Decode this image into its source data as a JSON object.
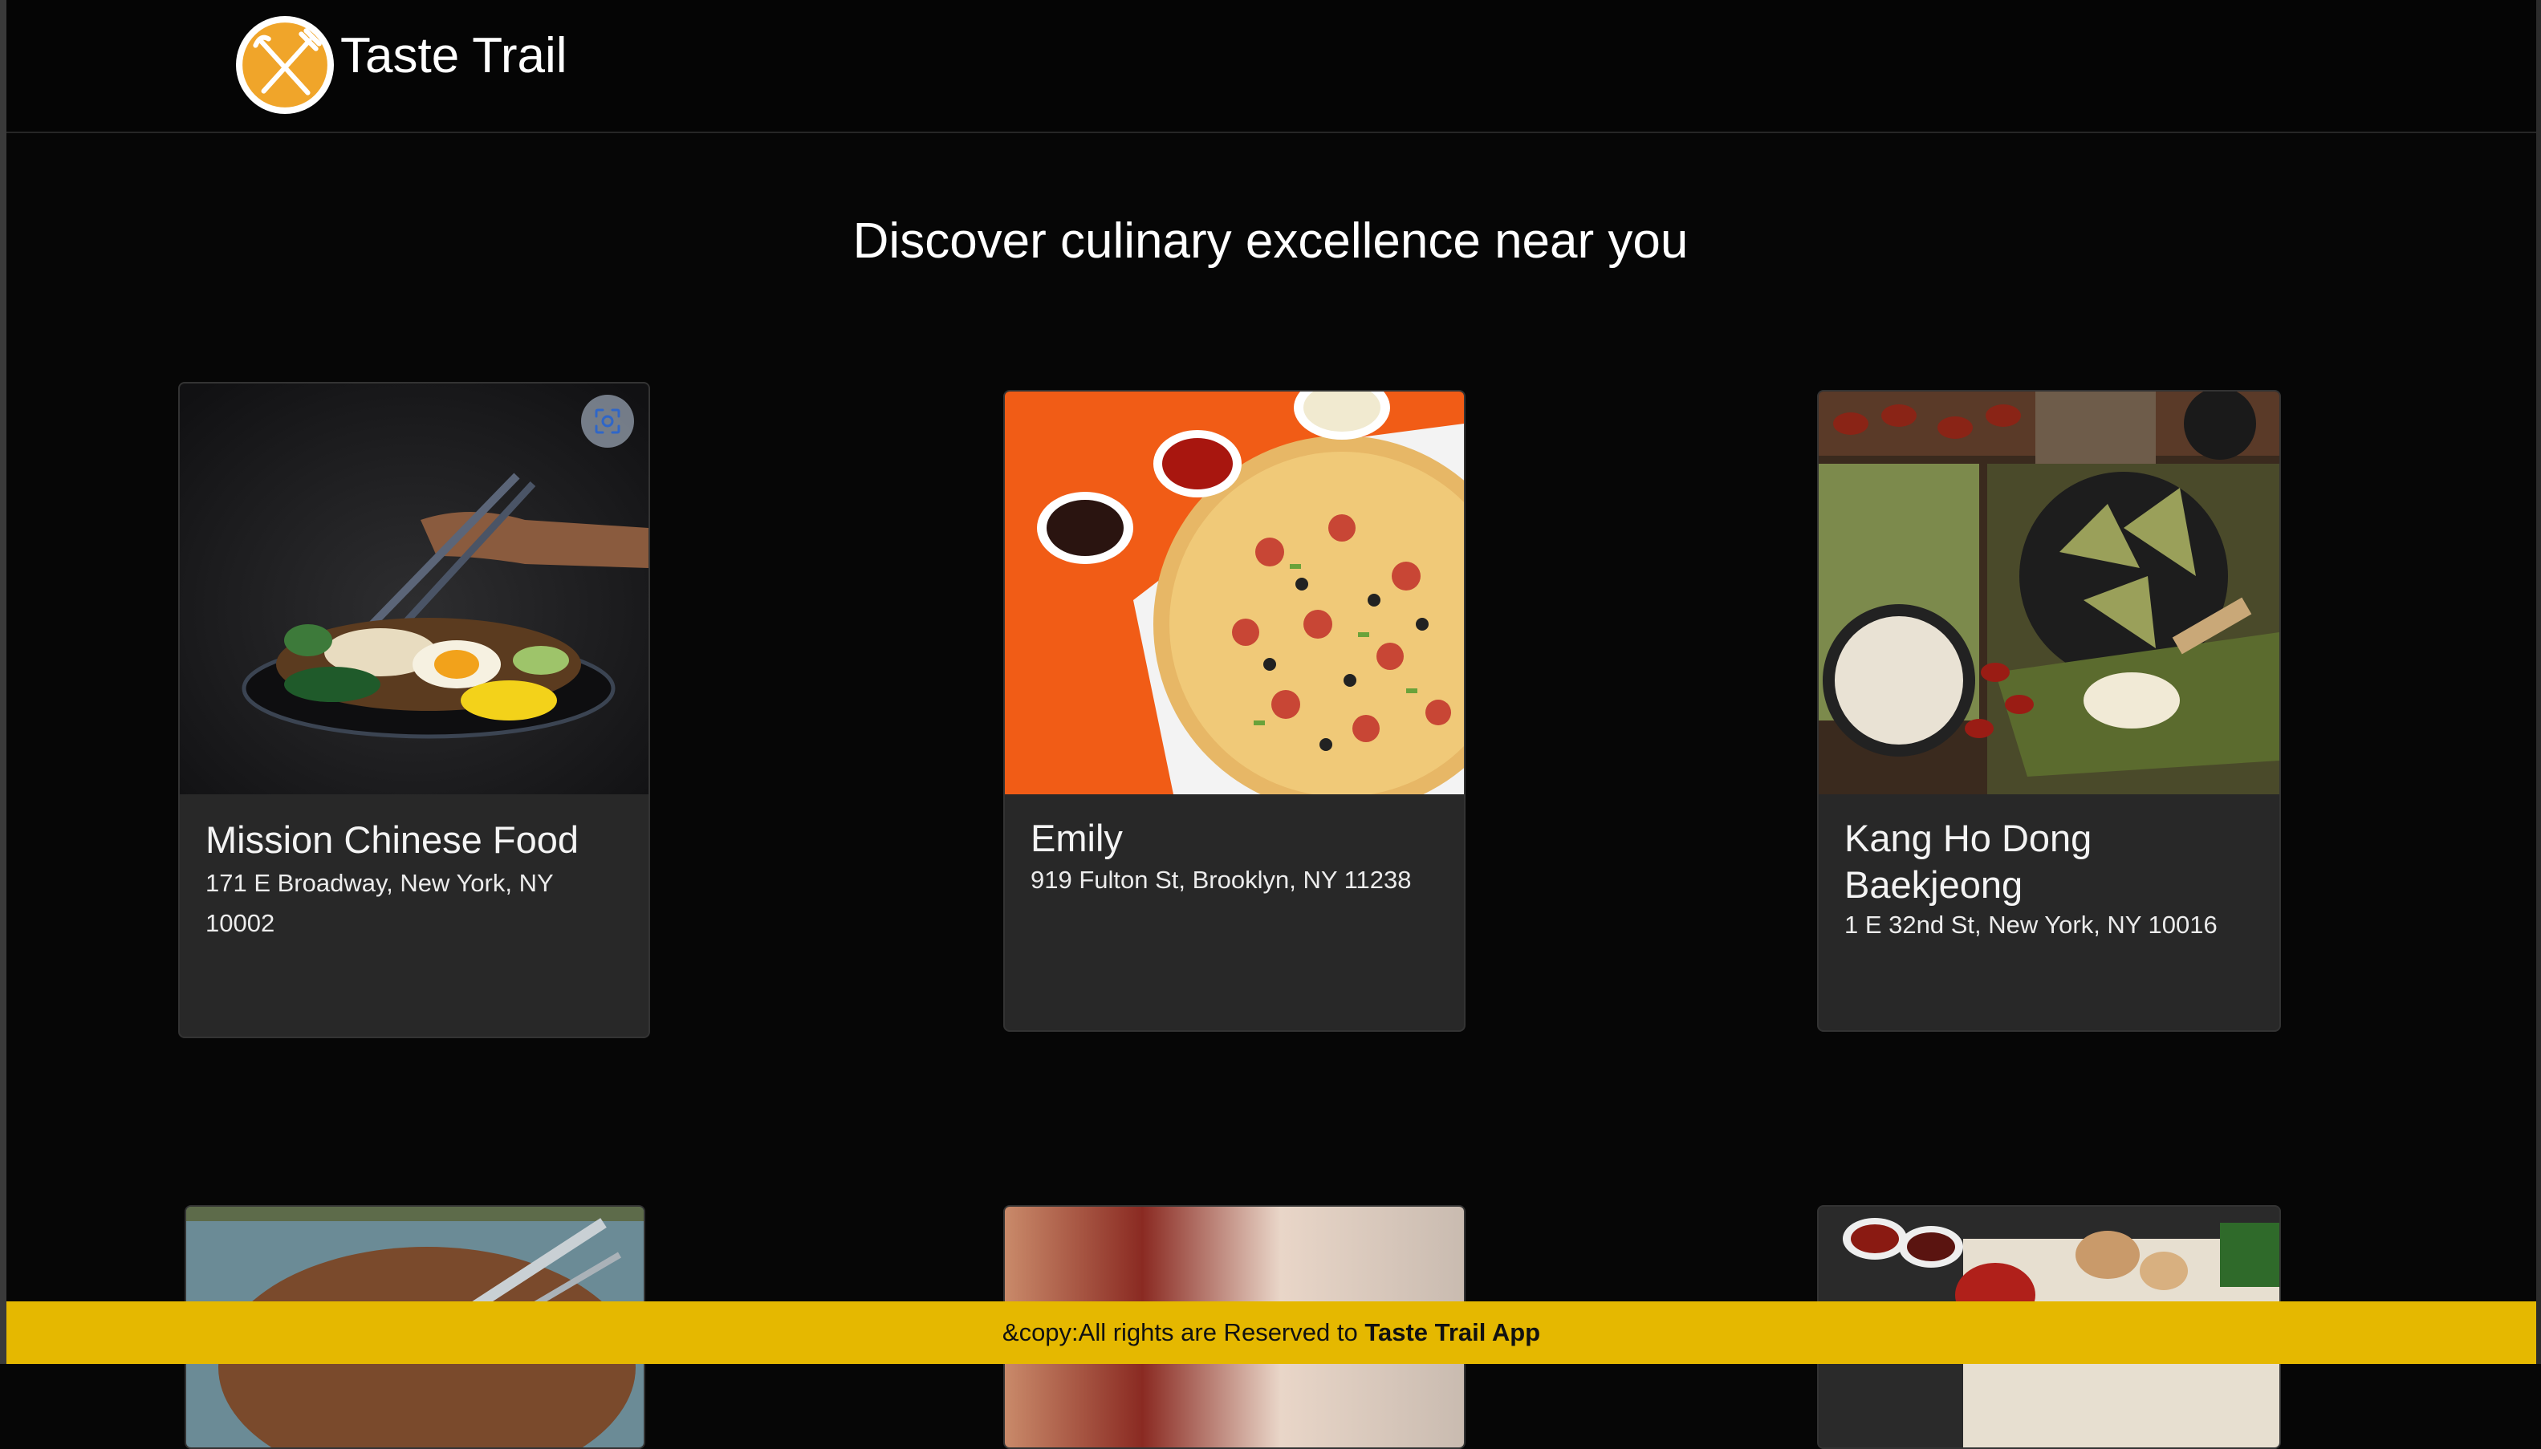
{
  "navbar": {
    "brand_name": "Taste Trail",
    "logo_icon": "fork-knife-icon",
    "brand_color": "#f0a52a"
  },
  "hero": {
    "headline": "Discover culinary excellence near you"
  },
  "restaurants": [
    {
      "name": "Mission Chinese Food",
      "address": "171 E Broadway, New York, NY 10002",
      "image": "noodle-bowl-photo"
    },
    {
      "name": "Emily",
      "address": "919 Fulton St, Brooklyn, NY 11238",
      "image": "pizza-photo"
    },
    {
      "name": "Kang Ho Dong Baekjeong",
      "address": "1 E 32nd St, New York, NY 10016",
      "image": "dumplings-photo"
    },
    {
      "name": "",
      "address": "",
      "image": "steak-cutlery-photo"
    },
    {
      "name": "",
      "address": "",
      "image": "blurred-table-photo"
    },
    {
      "name": "",
      "address": "",
      "image": "grilled-peppers-photo"
    }
  ],
  "overlay": {
    "lens_icon": "visual-search-icon"
  },
  "footer": {
    "prefix": "&copy:All rights are Reserved to ",
    "brand": "Taste Trail App",
    "background": "#e5b800"
  }
}
